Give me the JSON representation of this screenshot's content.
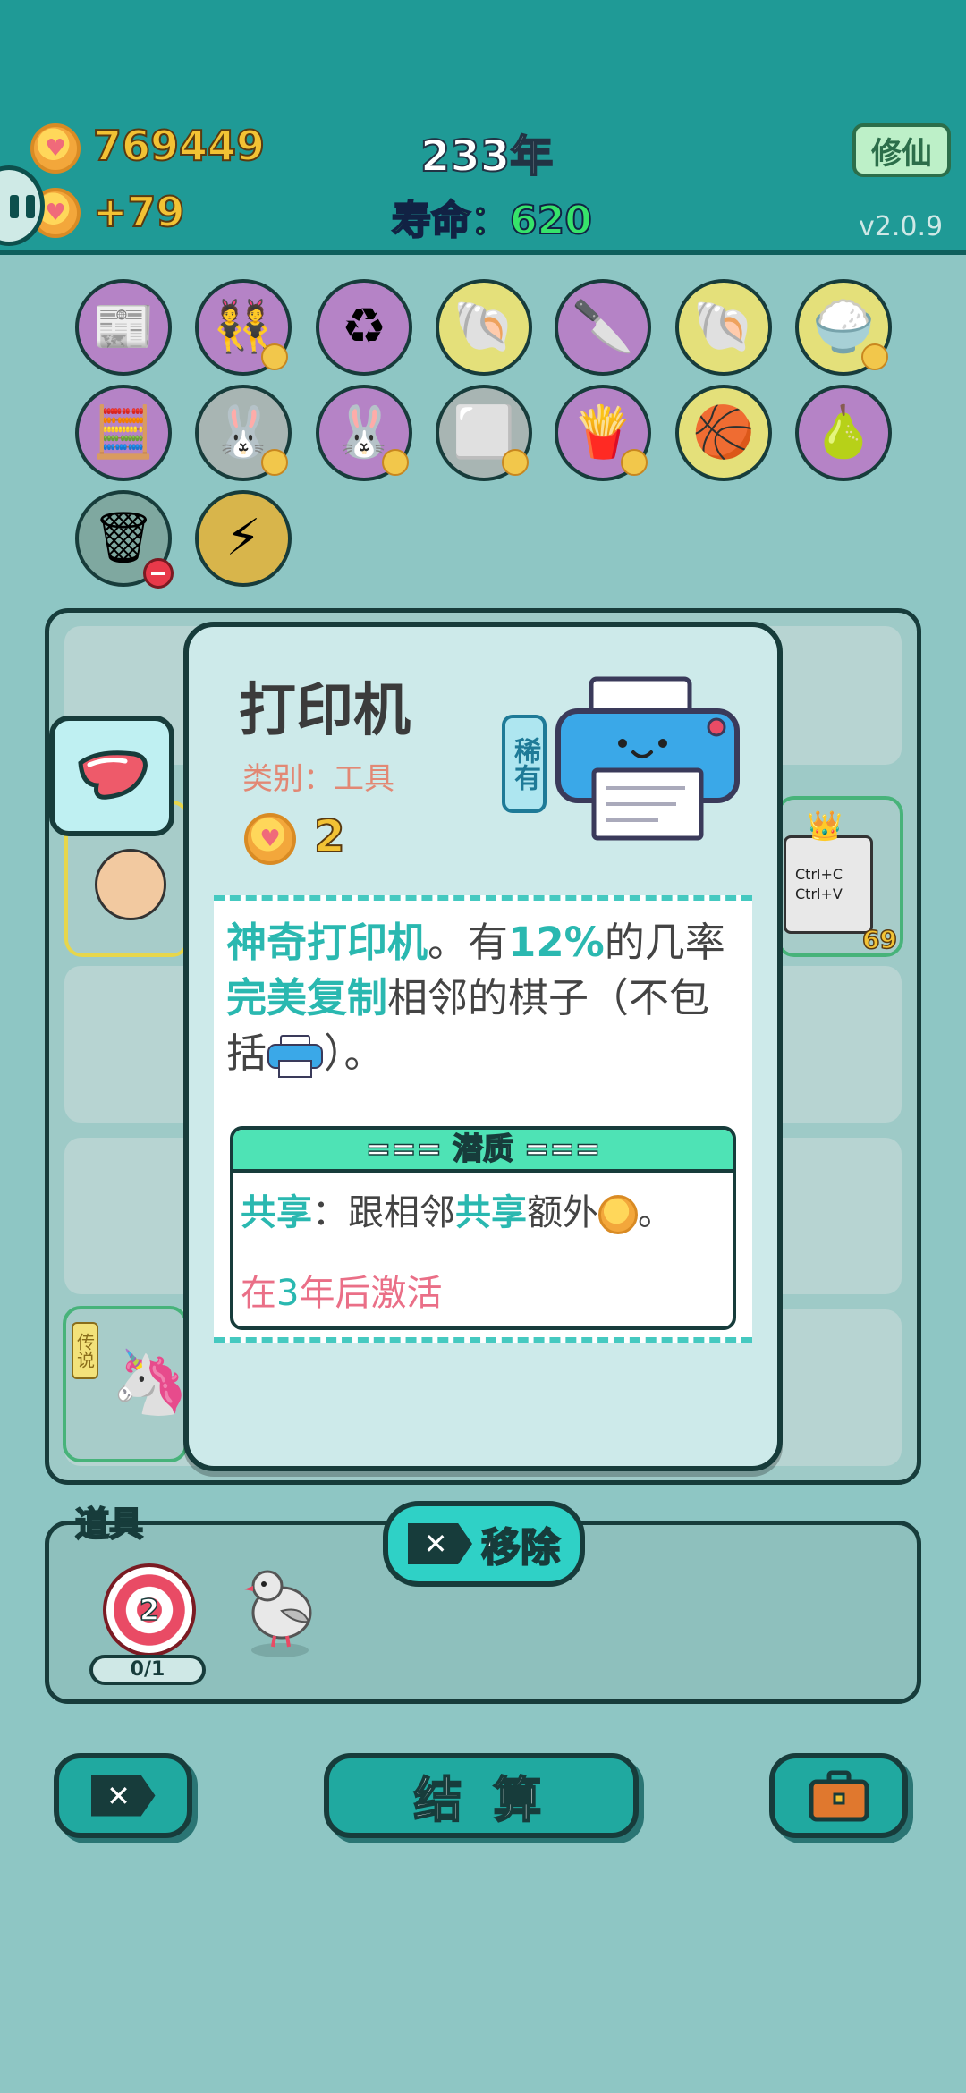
{
  "header": {
    "coins": "769449",
    "income": "+79",
    "year": "233年",
    "lifespan": "寿命：620",
    "xiuxian_label": "修仙",
    "version": "v2.0.9"
  },
  "symbols": [
    {
      "name": "time-magazine",
      "icon": "📰",
      "color": "purple"
    },
    {
      "name": "twins",
      "icon": "👯",
      "color": "purple"
    },
    {
      "name": "recycle",
      "icon": "♻",
      "color": "purple"
    },
    {
      "name": "shell",
      "icon": "🐚",
      "color": "yellow"
    },
    {
      "name": "cleaver",
      "icon": "🔪",
      "color": "purple"
    },
    {
      "name": "shell-2",
      "icon": "🐚",
      "color": "yellow"
    },
    {
      "name": "rice-bowl",
      "icon": "🍚",
      "color": "yellow"
    },
    {
      "name": "math-genius",
      "icon": "🧮",
      "color": "purple"
    },
    {
      "name": "rabbit",
      "icon": "🐰",
      "color": "gray"
    },
    {
      "name": "rabbit-2",
      "icon": "🐰",
      "color": "purple"
    },
    {
      "name": "sugar-cubes",
      "icon": "⬜",
      "color": "gray"
    },
    {
      "name": "fries",
      "icon": "🍟",
      "color": "purple"
    },
    {
      "name": "basketballs",
      "icon": "🏀",
      "color": "yellow"
    },
    {
      "name": "guava",
      "icon": "🍐",
      "color": "purple"
    },
    {
      "name": "garbage-bag",
      "icon": "🗑",
      "color": "teal"
    },
    {
      "name": "lightning",
      "icon": "⚡",
      "color": "gold"
    }
  ],
  "board": {
    "legend_tag": "传说",
    "copy_card": {
      "line1": "Ctrl+C",
      "line2": "Ctrl+V",
      "count": "69"
    }
  },
  "popup": {
    "title": "打印机",
    "category": "类别：工具",
    "value": "2",
    "rarity": "稀有",
    "description": {
      "p1": "神奇打印机",
      "p2": "。有",
      "p3": "12%",
      "p4": "的几率",
      "p5": "完美复制",
      "p6": "相邻的棋子（不包括",
      "p7": "）。"
    },
    "potential": {
      "header": "=== 潜质 ===",
      "l1a": "共享",
      "l1b": "：跟相邻",
      "l1c": "共享",
      "l1d": "额外",
      "l1e": "。",
      "l2a": "在",
      "l2b": "3",
      "l2c": "年后激活"
    }
  },
  "remove_button": {
    "label": "移除"
  },
  "items": {
    "label": "道具",
    "target_count": "2",
    "target_progress": "0/1",
    "target_progress_value": 0
  },
  "bottom": {
    "settle_label": "结 算"
  },
  "colors": {
    "header": "#1f9a96",
    "accent": "#2ab8b0",
    "pink": "#ea6f87",
    "gold": "#f2c234"
  }
}
